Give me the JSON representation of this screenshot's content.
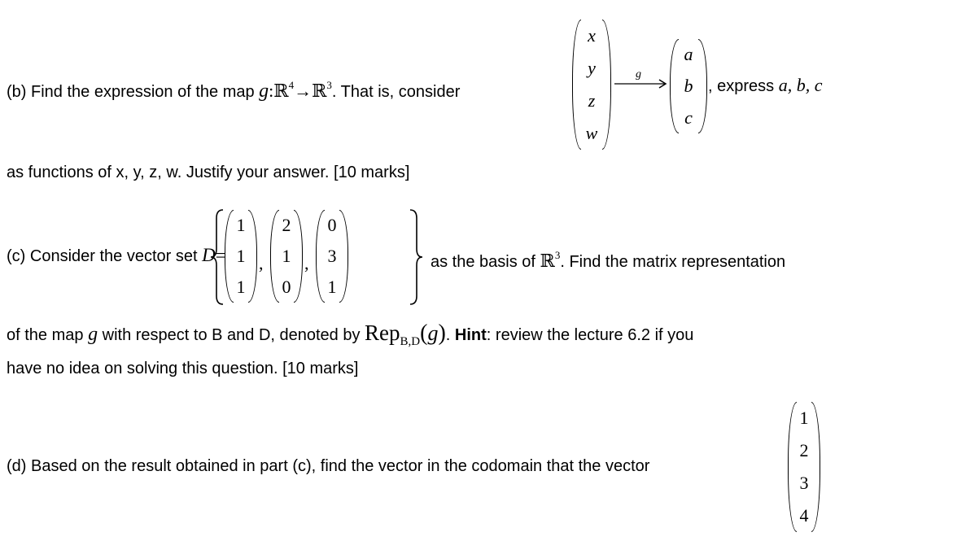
{
  "part_b": {
    "prefix": "(b) Find the expression of the map ",
    "map_name": "g",
    "colon": ":",
    "domain_space": "ℝ",
    "domain_dim": "4",
    "arrow": "→",
    "codomain_space": "ℝ",
    "codomain_dim": "3",
    "after_map": ". That is, consider",
    "input_vector": [
      "x",
      "y",
      "z",
      "w"
    ],
    "arrow_label": "g",
    "output_vector": [
      "a",
      "b",
      "c"
    ],
    "after_vector_comma": ", express ",
    "express_vars": "a, b, c",
    "line2": "as functions of x, y, z, w. Justify your answer. [10 marks]"
  },
  "part_c": {
    "prefix": "(c) Consider the vector set ",
    "set_name": "D",
    "equals": "=",
    "vectors": [
      [
        "1",
        "1",
        "1"
      ],
      [
        "2",
        "1",
        "0"
      ],
      [
        "0",
        "3",
        "1"
      ]
    ],
    "after_set": "as the basis of ",
    "space": "ℝ",
    "space_dim": "3",
    "after_space": ". Find the matrix representation",
    "line2_a": "of the map ",
    "line2_map": "g",
    "line2_b": " with respect to B and D, denoted by ",
    "rep": "Rep",
    "rep_sub": "B,D",
    "rep_arg": "g",
    "hint_label": "Hint",
    "hint_text": ": review the lecture 6.2 if you",
    "line3": "have no idea on solving this question. [10 marks]"
  },
  "part_d": {
    "text": "(d) Based on the result obtained in part (c), find the vector in the codomain that the vector",
    "vector": [
      "1",
      "2",
      "3",
      "4"
    ]
  }
}
